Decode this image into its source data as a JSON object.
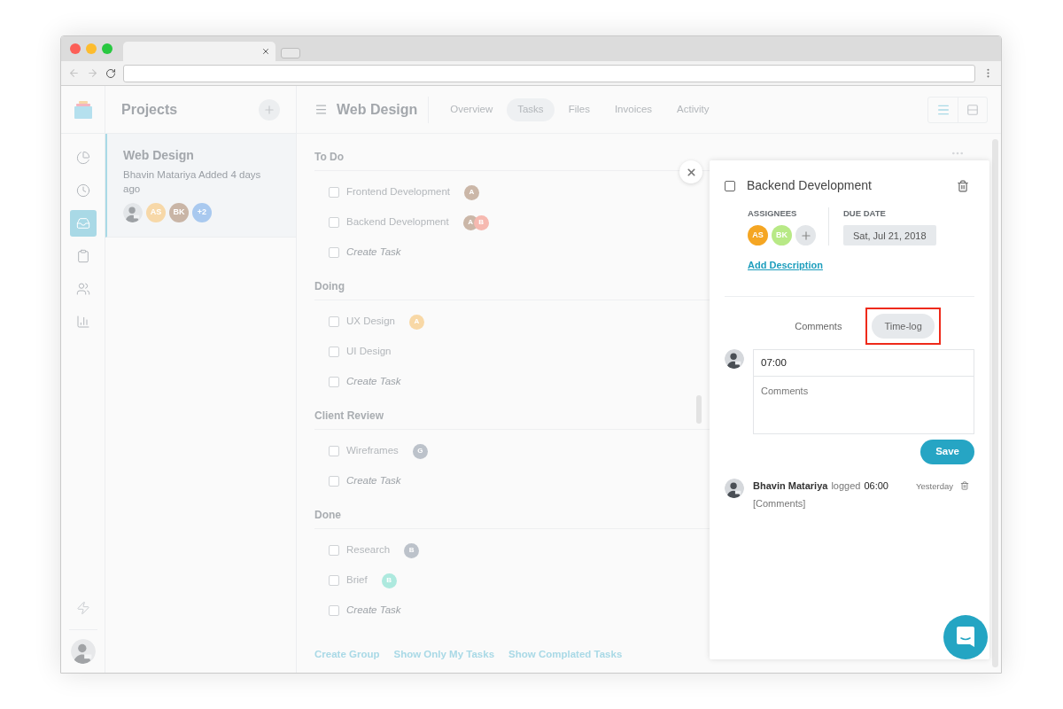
{
  "rail": [
    {
      "kind": "pie",
      "selected": false
    },
    {
      "kind": "clock",
      "selected": false
    },
    {
      "kind": "inbox",
      "selected": true
    },
    {
      "kind": "clipboard",
      "selected": false
    },
    {
      "kind": "users",
      "selected": false
    },
    {
      "kind": "chart",
      "selected": false
    }
  ],
  "projects": {
    "title": "Projects",
    "items": [
      {
        "name": "Web Design",
        "meta": "Bhavin Matariya Added 4 days ago",
        "selected": true,
        "avatars": [
          {
            "kind": "photo"
          },
          {
            "kind": "initials",
            "initials": "AS",
            "color": "#f7d8a8"
          },
          {
            "kind": "initials",
            "initials": "BK",
            "color": "#c9b5a6"
          },
          {
            "kind": "initials",
            "initials": "+2",
            "color": "#a9c9ef"
          }
        ]
      }
    ]
  },
  "header": {
    "title": "Web Design",
    "tabs": [
      {
        "label": "Overview",
        "selected": false
      },
      {
        "label": "Tasks",
        "selected": true
      },
      {
        "label": "Files",
        "selected": false
      },
      {
        "label": "Invoices",
        "selected": false
      },
      {
        "label": "Activity",
        "selected": false
      }
    ],
    "views": [
      {
        "kind": "list",
        "selected": true
      },
      {
        "kind": "split",
        "selected": false
      }
    ]
  },
  "groups": [
    {
      "title": "To Do",
      "tasks": [
        {
          "kind": "task",
          "name": "Frontend Development",
          "checked": false,
          "assignees": [
            {
              "initials": "A",
              "color": "#cbb7a8"
            }
          ]
        },
        {
          "kind": "task",
          "name": "Backend Development",
          "checked": false,
          "assignees": [
            {
              "initials": "A",
              "color": "#cbb7a8"
            },
            {
              "initials": "B",
              "color": "#f6b9b0"
            }
          ]
        },
        {
          "kind": "create",
          "name": "Create Task",
          "checked": false
        }
      ]
    },
    {
      "title": "Doing",
      "tasks": [
        {
          "kind": "task",
          "name": "UX Design",
          "checked": false,
          "assignees": [
            {
              "initials": "A",
              "color": "#f8d8a6"
            }
          ]
        },
        {
          "kind": "task",
          "name": "UI Design",
          "checked": false
        },
        {
          "kind": "create",
          "name": "Create Task",
          "checked": false
        }
      ]
    },
    {
      "title": "Client Review",
      "tasks": [
        {
          "kind": "task",
          "name": "Wireframes",
          "checked": false,
          "assignees": [
            {
              "initials": "G",
              "color": "#bcc2ca"
            }
          ]
        },
        {
          "kind": "create",
          "name": "Create Task",
          "checked": false
        }
      ]
    },
    {
      "title": "Done",
      "tasks": [
        {
          "kind": "task",
          "name": "Research",
          "checked": false,
          "assignees": [
            {
              "initials": "B",
              "color": "#bcc2ca"
            }
          ]
        },
        {
          "kind": "task",
          "name": "Brief",
          "checked": false,
          "assignees": [
            {
              "initials": "B",
              "color": "#ade9de"
            }
          ]
        },
        {
          "kind": "create",
          "name": "Create Task",
          "checked": false
        }
      ]
    }
  ],
  "footer_links": [
    "Create Group",
    "Show Only My Tasks",
    "Show Complated Tasks"
  ],
  "detail": {
    "title": "Backend Development",
    "checked": false,
    "assignees_label": "ASSIGNEES",
    "assignees": [
      {
        "initials": "AS",
        "color": "#f5a623"
      },
      {
        "initials": "BK",
        "color": "#b8e986"
      }
    ],
    "due_label": "DUE DATE",
    "due_date": "Sat, Jul 21, 2018",
    "add_description": "Add Description",
    "tabs": [
      {
        "label": "Comments",
        "selected": false,
        "highlighted": false
      },
      {
        "label": "Time-log",
        "selected": true,
        "highlighted": true
      }
    ],
    "time_value": "07:00",
    "comment_placeholder": "Comments",
    "save": "Save",
    "log": {
      "user": "Bhavin Matariya",
      "action": "logged",
      "time": "06:00",
      "when": "Yesterday",
      "comment": "[Comments]"
    }
  }
}
